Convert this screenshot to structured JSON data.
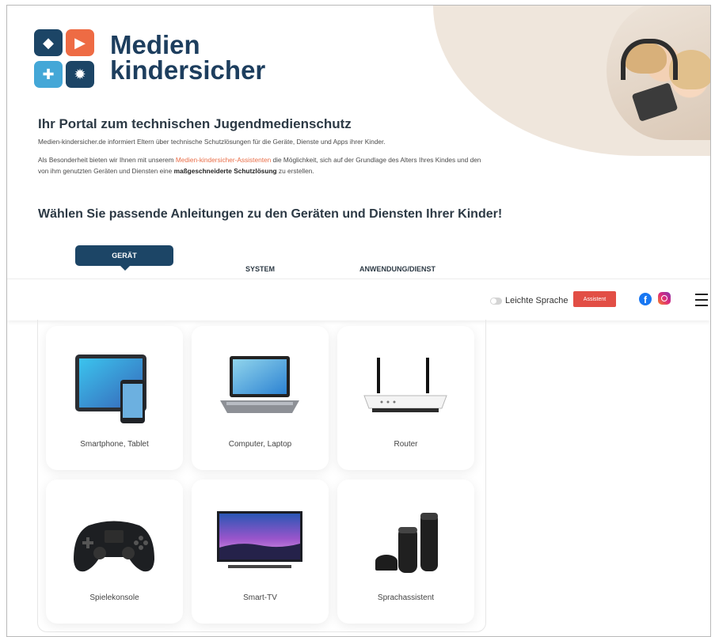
{
  "brand": {
    "line1": "Medien",
    "line2": "kindersicher"
  },
  "intro": {
    "title": "Ihr Portal zum technischen Jugendmedienschutz",
    "p1": "Medien-kindersicher.de informiert Eltern über technische Schutzlösungen für die Geräte, Dienste und Apps ihrer Kinder.",
    "p2_a": "Als Besonderheit bieten wir Ihnen mit unserem ",
    "p2_link": "Medien-kindersicher-Assistenten",
    "p2_b": " die Möglichkeit, sich auf der Grundlage des Alters Ihres Kindes und den von ihm genutzten Geräten und Diensten eine ",
    "p2_bold": "maßgeschneiderte Schutzlösung",
    "p2_c": " zu erstellen."
  },
  "choose_title": "Wählen Sie passende Anleitungen zu den Geräten und Diensten Ihrer Kinder!",
  "steps": {
    "active": "GERÄT",
    "system": "SYSTEM",
    "app": "ANWENDUNG/DIENST"
  },
  "toolbar": {
    "light_language": "Leichte Sprache",
    "assistant_button": "Assistent"
  },
  "devices": [
    {
      "label": "Smartphone, Tablet",
      "icon": "tablet-phone-icon"
    },
    {
      "label": "Computer, Laptop",
      "icon": "laptop-icon"
    },
    {
      "label": "Router",
      "icon": "router-icon"
    },
    {
      "label": "Spielekonsole",
      "icon": "gamepad-icon"
    },
    {
      "label": "Smart-TV",
      "icon": "tv-icon"
    },
    {
      "label": "Sprachassistent",
      "icon": "smart-speaker-icon"
    }
  ],
  "colors": {
    "navy": "#1c4566",
    "orange": "#ee6b44",
    "blue": "#44a7d7",
    "assistant_red": "#e24e45"
  }
}
